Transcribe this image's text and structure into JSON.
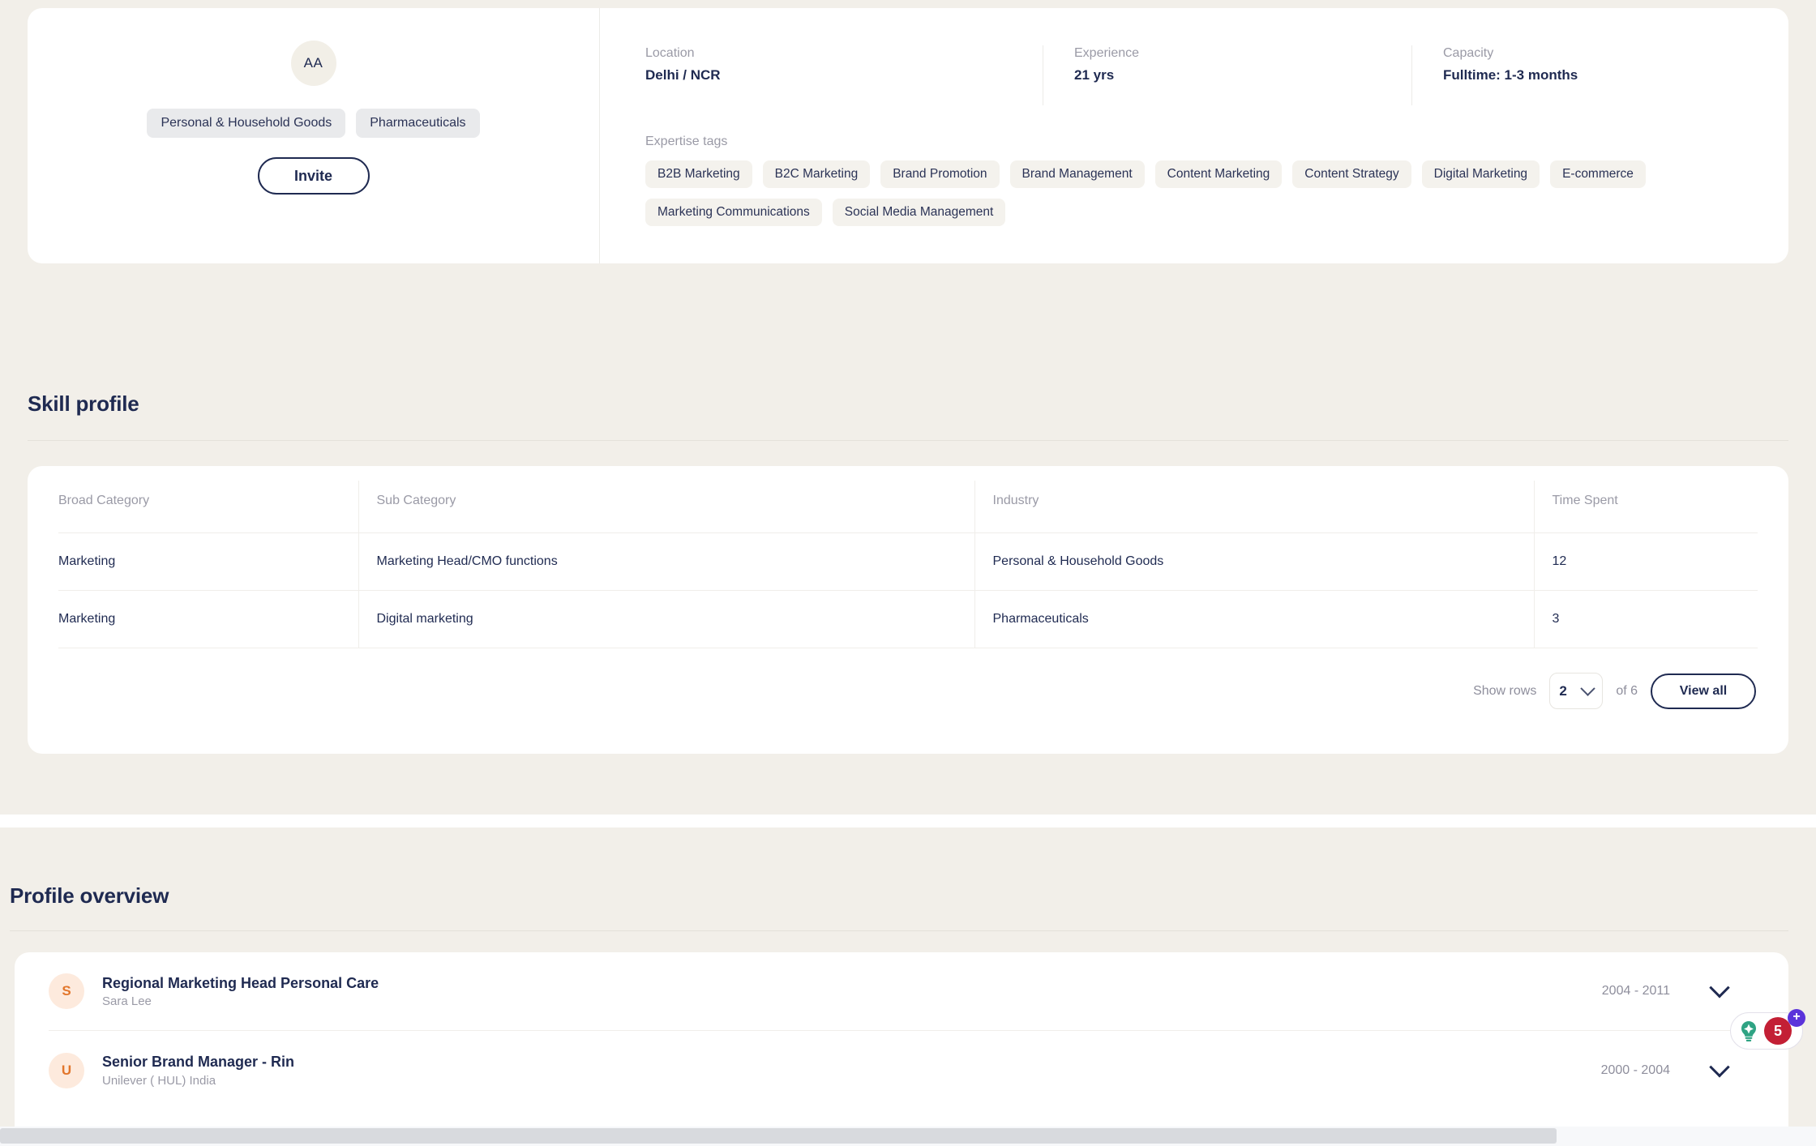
{
  "profile": {
    "avatar_initials": "AA",
    "industry_pills": [
      "Personal & Household Goods",
      "Pharmaceuticals"
    ],
    "invite_label": "Invite",
    "facts": [
      {
        "label": "Location",
        "value": "Delhi / NCR"
      },
      {
        "label": "Experience",
        "value": "21 yrs"
      },
      {
        "label": "Capacity",
        "value": "Fulltime: 1-3 months"
      }
    ],
    "expertise_label": "Expertise tags",
    "expertise_tags": [
      "B2B Marketing",
      "B2C Marketing",
      "Brand Promotion",
      "Brand Management",
      "Content Marketing",
      "Content Strategy",
      "Digital Marketing",
      "E-commerce",
      "Marketing Communications",
      "Social Media Management"
    ]
  },
  "skill_profile": {
    "heading": "Skill profile",
    "columns": [
      "Broad Category",
      "Sub Category",
      "Industry",
      "Time Spent"
    ],
    "rows": [
      [
        "Marketing",
        "Marketing Head/CMO functions",
        "Personal & Household Goods",
        "12"
      ],
      [
        "Marketing",
        "Digital marketing",
        "Pharmaceuticals",
        "3"
      ]
    ],
    "footer": {
      "show_rows_label": "Show rows",
      "rows_value": "2",
      "of_label": "of 6",
      "view_all_label": "View all"
    }
  },
  "profile_overview": {
    "heading": "Profile overview",
    "entries": [
      {
        "initial": "S",
        "title": "Regional Marketing Head Personal Care",
        "company": "Sara Lee",
        "dates": "2004 - 2011"
      },
      {
        "initial": "U",
        "title": "Senior Brand Manager - Rin",
        "company": "Unilever ( HUL) India",
        "dates": "2000 - 2004"
      }
    ]
  },
  "help_widget": {
    "icon": "lightbulb-icon",
    "count": "5",
    "plus": "+"
  },
  "colors": {
    "page_background": "#f2efe9",
    "card_background": "#ffffff",
    "primary_text": "#1f2a51",
    "muted_text": "#9a9aa6",
    "pill_background": "#e9eaec",
    "tag_background": "#f4f2ed",
    "avatar_background": "#f2efe7",
    "exp_avatar_background": "#fdeadd",
    "exp_avatar_text": "#e2762b",
    "badge_red": "#c31f35",
    "badge_purple": "#5b33da",
    "bulb_green": "#2fa383"
  }
}
